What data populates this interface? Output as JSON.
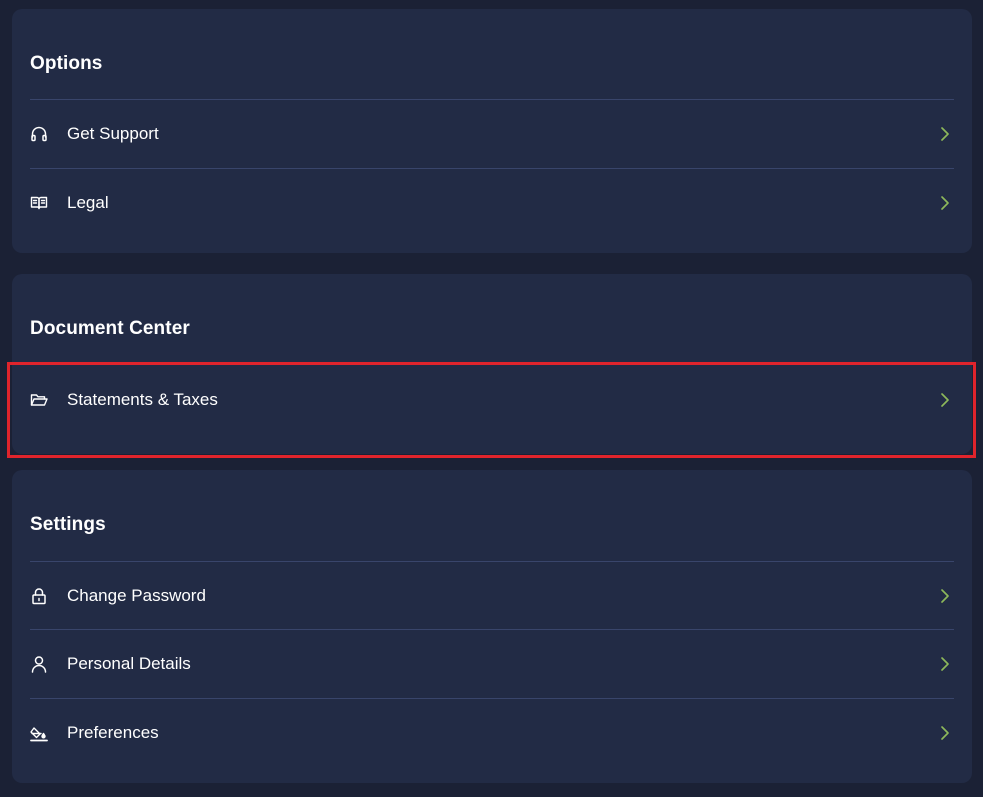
{
  "sections": [
    {
      "title": "Options",
      "items": [
        {
          "label": "Get Support",
          "icon": "headphones-icon"
        },
        {
          "label": "Legal",
          "icon": "book-icon"
        }
      ]
    },
    {
      "title": "Document Center",
      "items": [
        {
          "label": "Statements & Taxes",
          "icon": "folder-open-icon"
        }
      ]
    },
    {
      "title": "Settings",
      "items": [
        {
          "label": "Change Password",
          "icon": "lock-icon"
        },
        {
          "label": "Personal Details",
          "icon": "user-icon"
        },
        {
          "label": "Preferences",
          "icon": "paint-bucket-icon"
        }
      ]
    }
  ],
  "colors": {
    "page_background": "#1b2135",
    "card_background": "#222b45",
    "divider": "#39456b",
    "chevron_accent": "#8db85a",
    "highlight_border": "#e0242c"
  }
}
